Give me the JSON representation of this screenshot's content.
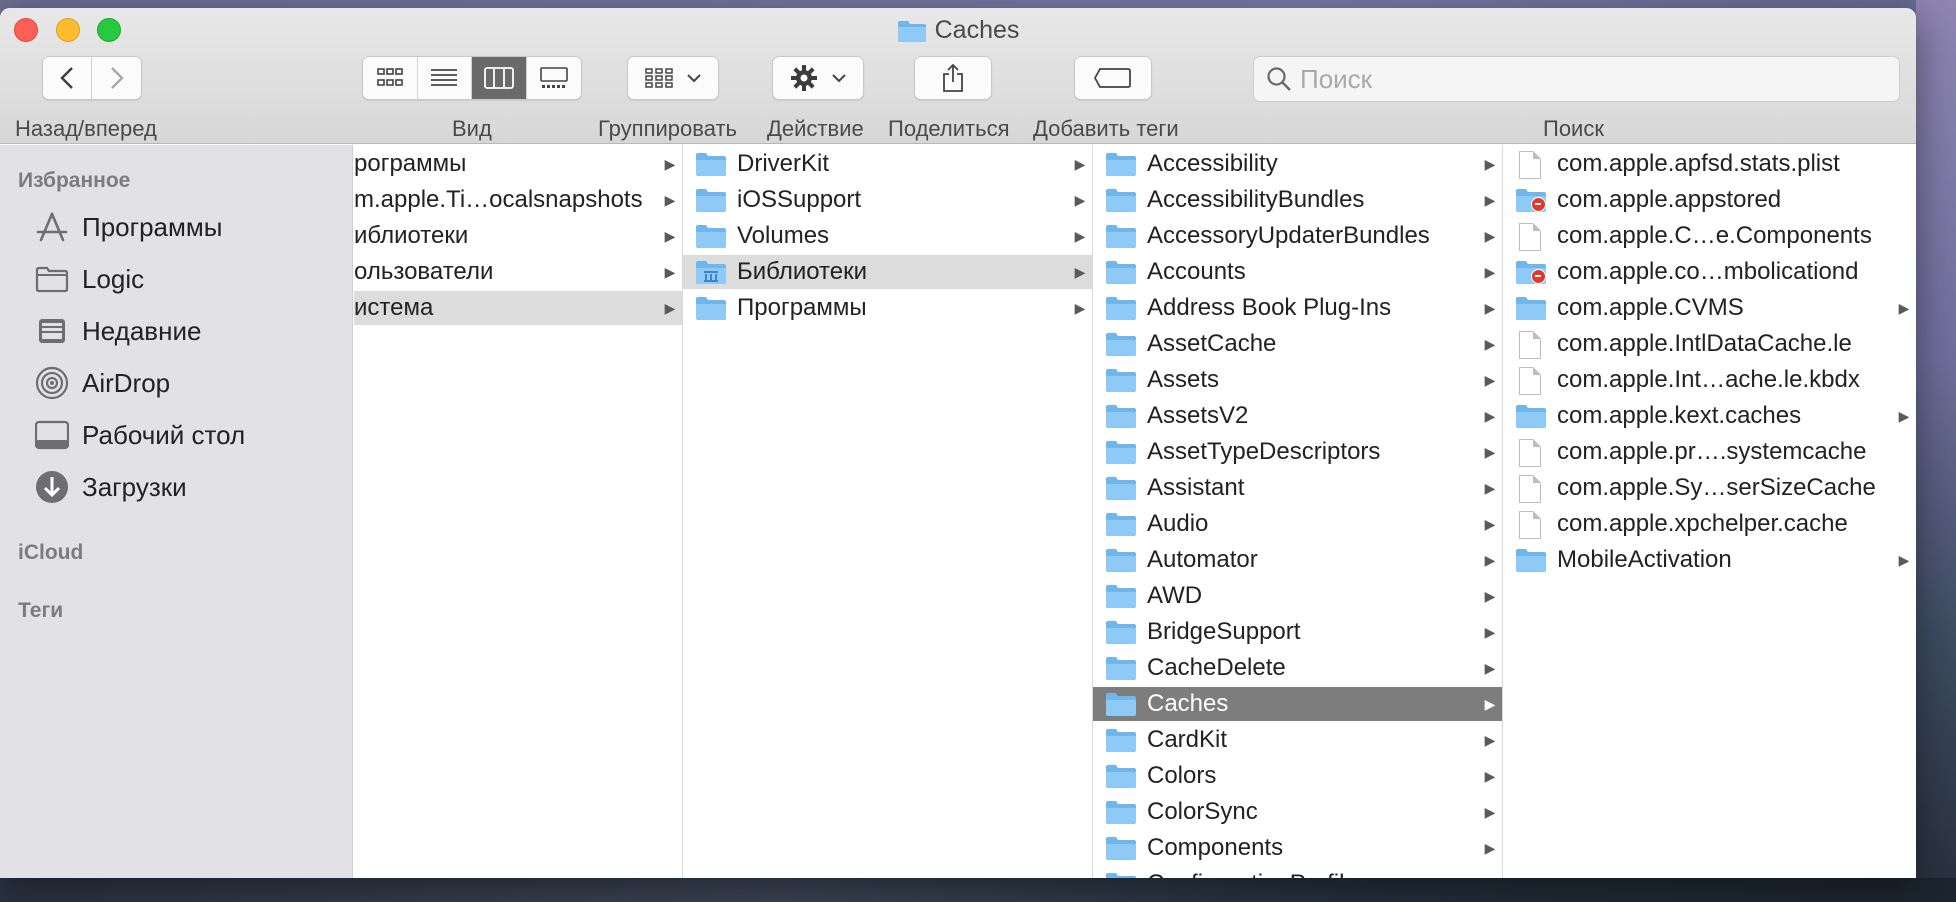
{
  "window": {
    "title": "Caches",
    "accent_color": "#7d7d7d",
    "folder_color": "#7cc1f2"
  },
  "toolbar": {
    "nav_label": "Назад/вперед",
    "view_label": "Вид",
    "group_label": "Группировать",
    "action_label": "Действие",
    "share_label": "Поделиться",
    "tags_label": "Добавить теги",
    "search_label": "Поиск",
    "search_placeholder": "Поиск",
    "active_view": "columns"
  },
  "sidebar": {
    "favorites_header": "Избранное",
    "items": [
      {
        "label": "Программы",
        "icon": "applications-icon"
      },
      {
        "label": "Logic",
        "icon": "folder-icon"
      },
      {
        "label": "Недавние",
        "icon": "recents-icon"
      },
      {
        "label": "AirDrop",
        "icon": "airdrop-icon"
      },
      {
        "label": "Рабочий стол",
        "icon": "desktop-icon"
      },
      {
        "label": "Загрузки",
        "icon": "downloads-icon"
      }
    ],
    "icloud_header": "iCloud",
    "tags_header": "Теги"
  },
  "columns": [
    {
      "items": [
        {
          "label": "рограммы",
          "arrow": true
        },
        {
          "label": "m.apple.Ti…ocalsnapshots",
          "arrow": true
        },
        {
          "label": "иблиотеки",
          "arrow": true
        },
        {
          "label": "ользователи",
          "arrow": true
        },
        {
          "label": "истема",
          "arrow": true,
          "selected": "grey"
        }
      ]
    },
    {
      "items": [
        {
          "label": "DriverKit",
          "icon": "folder",
          "arrow": true
        },
        {
          "label": "iOSSupport",
          "icon": "folder",
          "arrow": true
        },
        {
          "label": "Volumes",
          "icon": "folder",
          "arrow": true
        },
        {
          "label": "Библиотеки",
          "icon": "library-folder",
          "arrow": true,
          "selected": "grey"
        },
        {
          "label": "Программы",
          "icon": "folder",
          "arrow": true
        }
      ]
    },
    {
      "items": [
        {
          "label": "Accessibility",
          "icon": "folder",
          "arrow": true
        },
        {
          "label": "AccessibilityBundles",
          "icon": "folder",
          "arrow": true
        },
        {
          "label": "AccessoryUpdaterBundles",
          "icon": "folder",
          "arrow": true
        },
        {
          "label": "Accounts",
          "icon": "folder",
          "arrow": true
        },
        {
          "label": "Address Book Plug-Ins",
          "icon": "folder",
          "arrow": true
        },
        {
          "label": "AssetCache",
          "icon": "folder",
          "arrow": true
        },
        {
          "label": "Assets",
          "icon": "folder",
          "arrow": true
        },
        {
          "label": "AssetsV2",
          "icon": "folder",
          "arrow": true
        },
        {
          "label": "AssetTypeDescriptors",
          "icon": "folder",
          "arrow": true
        },
        {
          "label": "Assistant",
          "icon": "folder",
          "arrow": true
        },
        {
          "label": "Audio",
          "icon": "folder",
          "arrow": true
        },
        {
          "label": "Automator",
          "icon": "folder",
          "arrow": true
        },
        {
          "label": "AWD",
          "icon": "folder",
          "arrow": true
        },
        {
          "label": "BridgeSupport",
          "icon": "folder",
          "arrow": true
        },
        {
          "label": "CacheDelete",
          "icon": "folder",
          "arrow": true
        },
        {
          "label": "Caches",
          "icon": "folder",
          "arrow": true,
          "selected": "dark"
        },
        {
          "label": "CardKit",
          "icon": "folder",
          "arrow": true
        },
        {
          "label": "Colors",
          "icon": "folder",
          "arrow": true
        },
        {
          "label": "ColorSync",
          "icon": "folder",
          "arrow": true
        },
        {
          "label": "Components",
          "icon": "folder",
          "arrow": true
        },
        {
          "label": "ConfigurationProfiles",
          "icon": "folder",
          "arrow": true
        }
      ]
    },
    {
      "items": [
        {
          "label": "com.apple.apfsd.stats.plist",
          "icon": "file",
          "arrow": false
        },
        {
          "label": "com.apple.appstored",
          "icon": "folder-restricted",
          "arrow": false
        },
        {
          "label": "com.apple.C…e.Components",
          "icon": "file",
          "arrow": false
        },
        {
          "label": "com.apple.co…mbolicationd",
          "icon": "folder-restricted",
          "arrow": false
        },
        {
          "label": "com.apple.CVMS",
          "icon": "folder",
          "arrow": true
        },
        {
          "label": "com.apple.IntlDataCache.le",
          "icon": "file",
          "arrow": false
        },
        {
          "label": "com.apple.Int…ache.le.kbdx",
          "icon": "file",
          "arrow": false
        },
        {
          "label": "com.apple.kext.caches",
          "icon": "folder",
          "arrow": true
        },
        {
          "label": "com.apple.pr….systemcache",
          "icon": "file",
          "arrow": false
        },
        {
          "label": "com.apple.Sy…serSizeCache",
          "icon": "file",
          "arrow": false
        },
        {
          "label": "com.apple.xpchelper.cache",
          "icon": "file",
          "arrow": false
        },
        {
          "label": "MobileActivation",
          "icon": "folder",
          "arrow": true
        }
      ]
    }
  ]
}
